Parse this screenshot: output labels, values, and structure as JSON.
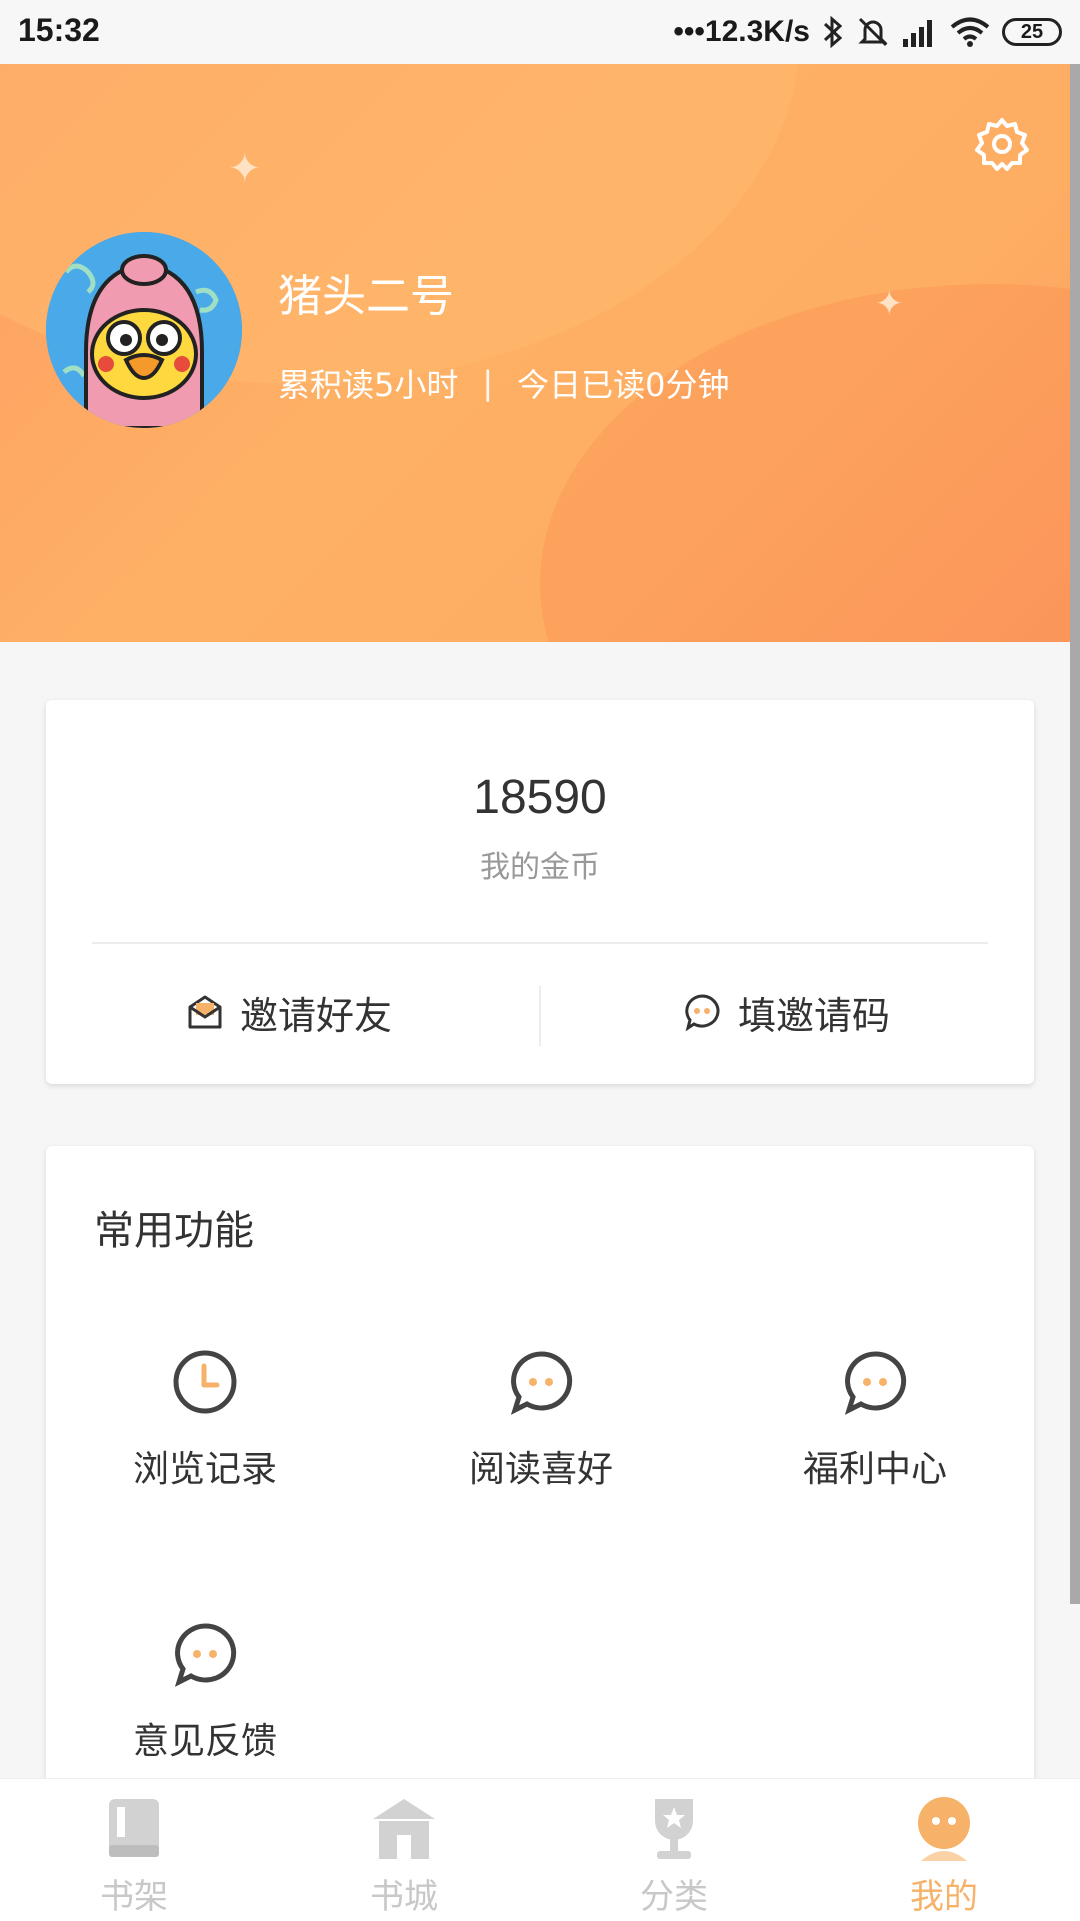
{
  "status_bar": {
    "time": "15:32",
    "signal_dots": "•••",
    "net_speed": "12.3K/s",
    "battery": "25"
  },
  "profile": {
    "username": "猪头二号",
    "total_read": "累积读5小时",
    "separator": "|",
    "today_read": "今日已读0分钟"
  },
  "coins": {
    "count": "18590",
    "label": "我的金币",
    "invite_label": "邀请好友",
    "code_label": "填邀请码"
  },
  "functions": {
    "title": "常用功能",
    "items": [
      {
        "label": "浏览记录",
        "icon": "clock-icon"
      },
      {
        "label": "阅读喜好",
        "icon": "chat-bubble-icon"
      },
      {
        "label": "福利中心",
        "icon": "chat-bubble-icon"
      },
      {
        "label": "意见反馈",
        "icon": "chat-bubble-icon"
      }
    ]
  },
  "nav": {
    "items": [
      {
        "label": "书架",
        "icon": "book-icon"
      },
      {
        "label": "书城",
        "icon": "store-icon"
      },
      {
        "label": "分类",
        "icon": "trophy-icon"
      },
      {
        "label": "我的",
        "icon": "profile-face-icon"
      }
    ],
    "active_index": 3
  },
  "colors": {
    "accent": "#f7b26a",
    "header_orange": "#feb065",
    "inactive_nav": "#c8c8c8"
  }
}
